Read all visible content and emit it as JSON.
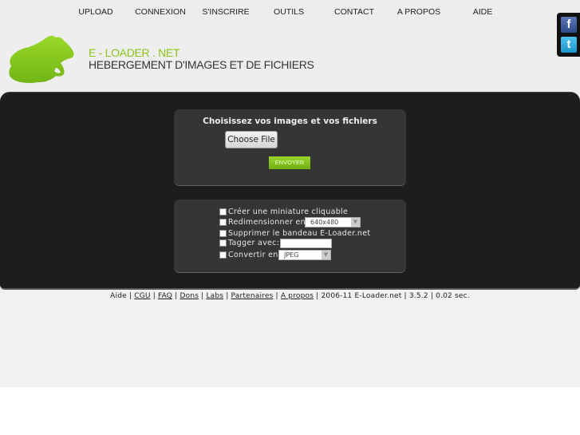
{
  "nav": [
    "UPLOAD",
    "CONNEXION",
    "S'INSCRIRE",
    "OUTILS",
    "CONTACT",
    "A PROPOS",
    "AIDE"
  ],
  "logo": {
    "line1": "E - LOADER . NET",
    "line2": "HEBERGEMENT D'IMAGES ET DE FICHIERS"
  },
  "social": {
    "facebook": "f",
    "twitter": "t"
  },
  "upload": {
    "title": "Choisissez vos images et vos fichiers",
    "choose_label": "Choose File",
    "send_label": "ENVOYER"
  },
  "options": {
    "thumb": "Créer une miniature cliquable",
    "resize": "Redimensionner en",
    "resize_value": "640x480",
    "banner": "Supprimer le bandeau E-Loader.net",
    "tag": "Tagger avec:",
    "tag_value": "",
    "convert": "Convertir en",
    "convert_value": "JPEG"
  },
  "footer": {
    "aide": "Aide",
    "links": [
      "CGU",
      "FAQ",
      "Dons",
      "Labs",
      "Partenaires",
      "A propos"
    ],
    "sep": " | ",
    "info": "2006-11 E-Loader.net | 3.5.2 | 0.02 sec."
  },
  "colors": {
    "accent": "#8cc51a",
    "dark": "#1d1d1d",
    "panel": "#353535"
  }
}
